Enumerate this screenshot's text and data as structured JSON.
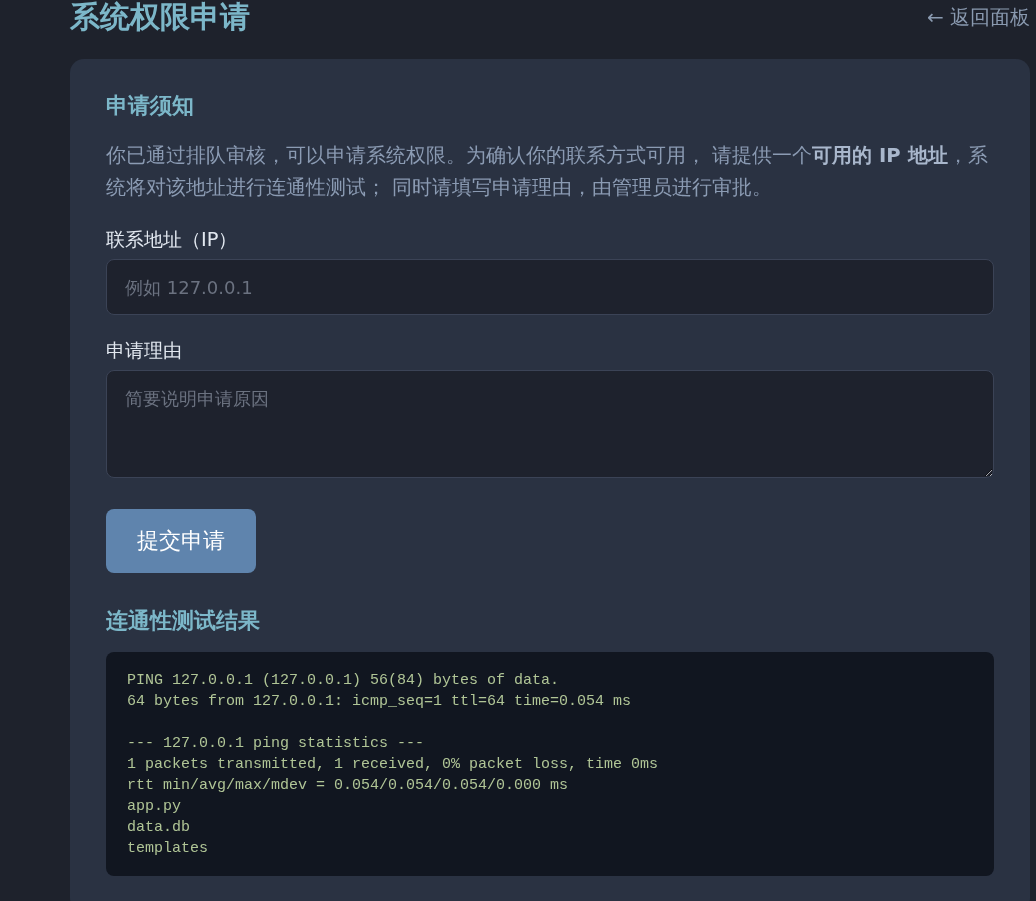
{
  "header": {
    "title": "系统权限申请",
    "back_link": "← 返回面板"
  },
  "notice": {
    "heading": "申请须知",
    "text": "你已通过排队审核，可以申请系统权限。为确认你的联系方式可用， 请提供一个**可用的 IP 地址**，系统将对该地址进行连通性测试； 同时请填写申请理由，由管理员进行审批。"
  },
  "form": {
    "fields": [
      {
        "kind": "input",
        "label": "联系地址（IP）",
        "placeholder": "例如 127.0.0.1"
      },
      {
        "kind": "textarea",
        "label": "申请理由",
        "placeholder": "简要说明申请原因"
      }
    ],
    "submit": "提交申请"
  },
  "result": {
    "heading": "连通性测试结果",
    "output": "PING 127.0.0.1 (127.0.0.1) 56(84) bytes of data.\n64 bytes from 127.0.0.1: icmp_seq=1 ttl=64 time=0.054 ms\n\n--- 127.0.0.1 ping statistics ---\n1 packets transmitted, 1 received, 0% packet loss, time 0ms\nrtt min/avg/max/mdev = 0.054/0.054/0.054/0.000 ms\napp.py\ndata.db\ntemplates"
  }
}
